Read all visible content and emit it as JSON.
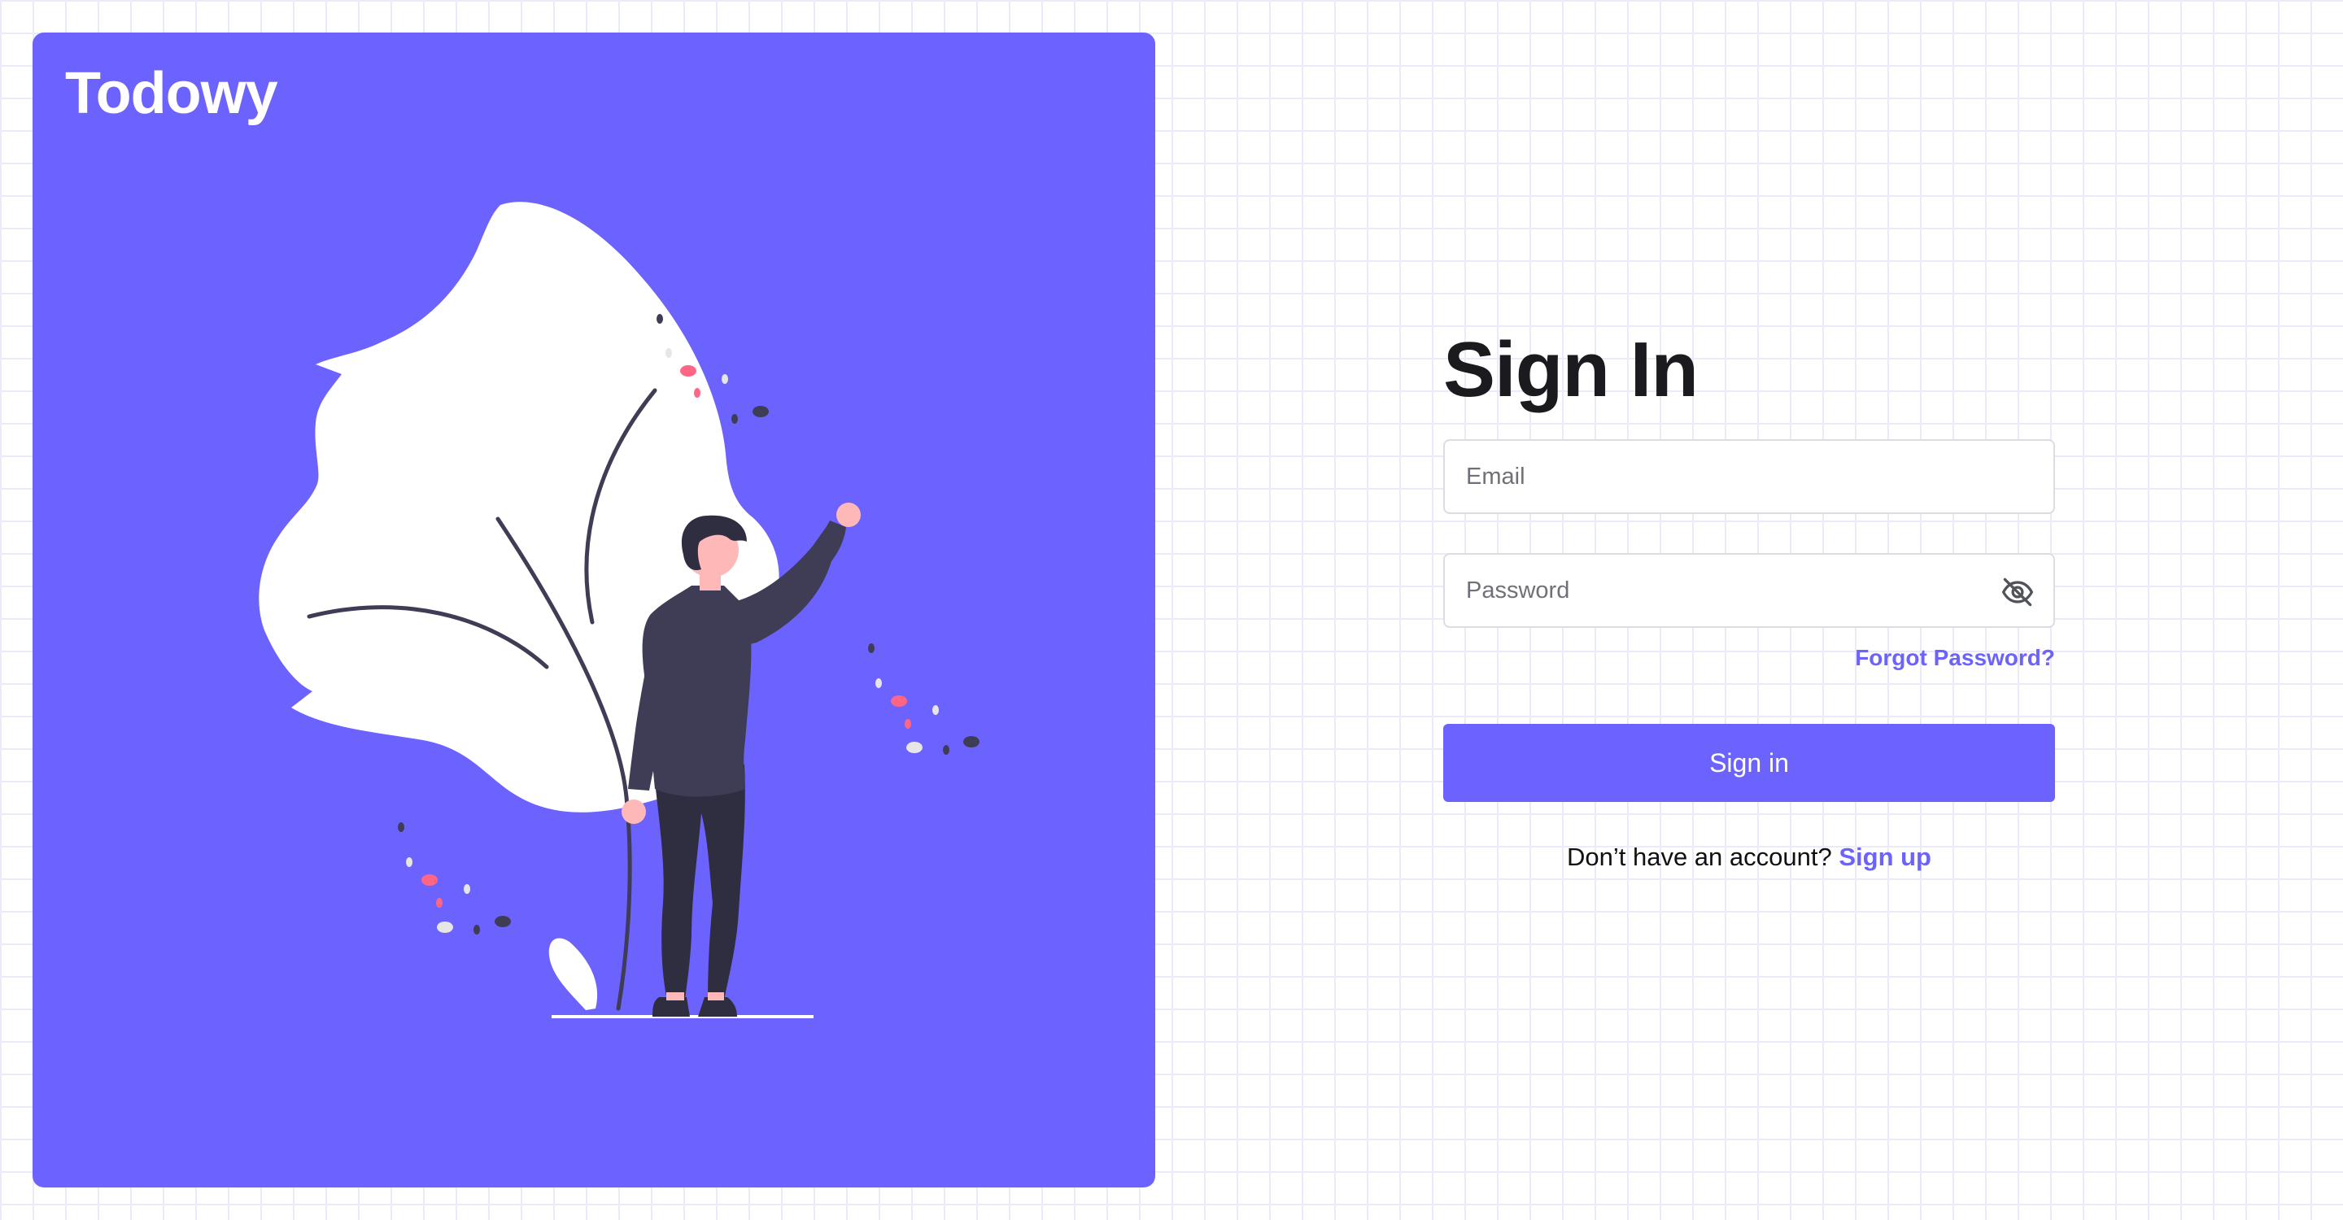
{
  "brand": {
    "name": "Todowy"
  },
  "illustration": {
    "name": "person-waving-beside-plant"
  },
  "colors": {
    "accent": "#6c63ff",
    "text": "#1b1b1f",
    "figure_dark": "#3f3d56",
    "skin": "#ffb8b8",
    "dot_pink": "#ff6584"
  },
  "form": {
    "title": "Sign In",
    "email": {
      "value": "",
      "placeholder": "Email"
    },
    "password": {
      "value": "",
      "placeholder": "Password",
      "toggle_icon": "eye-off-icon"
    },
    "forgot_label": "Forgot Password?",
    "submit_label": "Sign in",
    "signup_prompt": "Don’t have an account?",
    "signup_label": "Sign up"
  }
}
